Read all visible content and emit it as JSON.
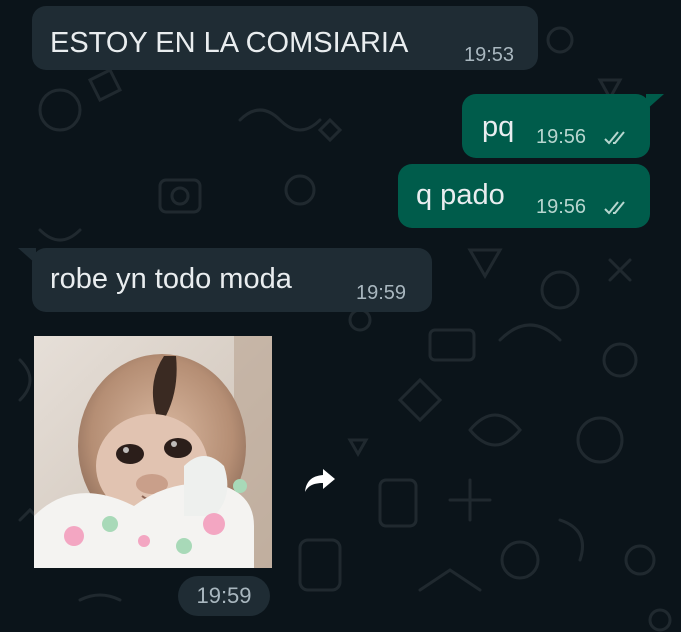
{
  "messages": [
    {
      "direction": "incoming",
      "text": "ESTOY EN LA COMSIARIA",
      "time": "19:53"
    },
    {
      "direction": "outgoing",
      "text": "pq",
      "time": "19:56",
      "status_icon": "double-check-icon"
    },
    {
      "direction": "outgoing",
      "text": "q pado",
      "time": "19:56",
      "status_icon": "double-check-icon"
    },
    {
      "direction": "incoming",
      "text": "robe yn todo moda",
      "time": "19:59"
    }
  ],
  "media_message": {
    "direction": "incoming",
    "kind": "sticker-gif",
    "subject": "baby monkey holding a towel",
    "time": "19:59",
    "action_icon": "forward-icon"
  },
  "colors": {
    "background": "#0b141a",
    "incoming_bubble": "#1f2c34",
    "outgoing_bubble": "#005c4b",
    "text": "#e9edef",
    "meta": "#a9b7bf"
  }
}
